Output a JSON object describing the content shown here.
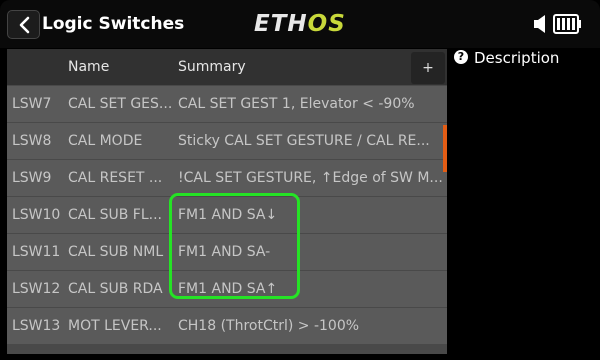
{
  "header": {
    "title": "Logic Switches",
    "logo_part1": "ETH",
    "logo_part2": "OS"
  },
  "table": {
    "columns": {
      "name": "Name",
      "summary": "Summary"
    },
    "add_label": "+",
    "rows": [
      {
        "id": "LSW7",
        "name": "CAL SET GES...",
        "summary": "CAL SET GEST 1, Elevator < -90%"
      },
      {
        "id": "LSW8",
        "name": "CAL MODE",
        "summary": "Sticky CAL SET GESTURE / CAL RE..."
      },
      {
        "id": "LSW9",
        "name": "CAL RESET ...",
        "summary": "!CAL SET GESTURE, ↑Edge of SW M..."
      },
      {
        "id": "LSW10",
        "name": "CAL SUB FL...",
        "summary": "FM1 AND SA↓"
      },
      {
        "id": "LSW11",
        "name": "CAL SUB NML",
        "summary": "FM1 AND SA-"
      },
      {
        "id": "LSW12",
        "name": "CAL SUB RDA",
        "summary": "FM1 AND SA↑"
      },
      {
        "id": "LSW13",
        "name": "MOT LEVER...",
        "summary": "CH18 (ThrotCtrl) > -100%"
      }
    ]
  },
  "side_panel": {
    "description_label": "Description"
  },
  "colors": {
    "accent_scroll": "#e35d15",
    "highlight": "#25e325",
    "logo_accent": "#c8d83a"
  },
  "icons": [
    "back-arrow-icon",
    "speaker-icon",
    "battery-icon",
    "help-icon"
  ]
}
